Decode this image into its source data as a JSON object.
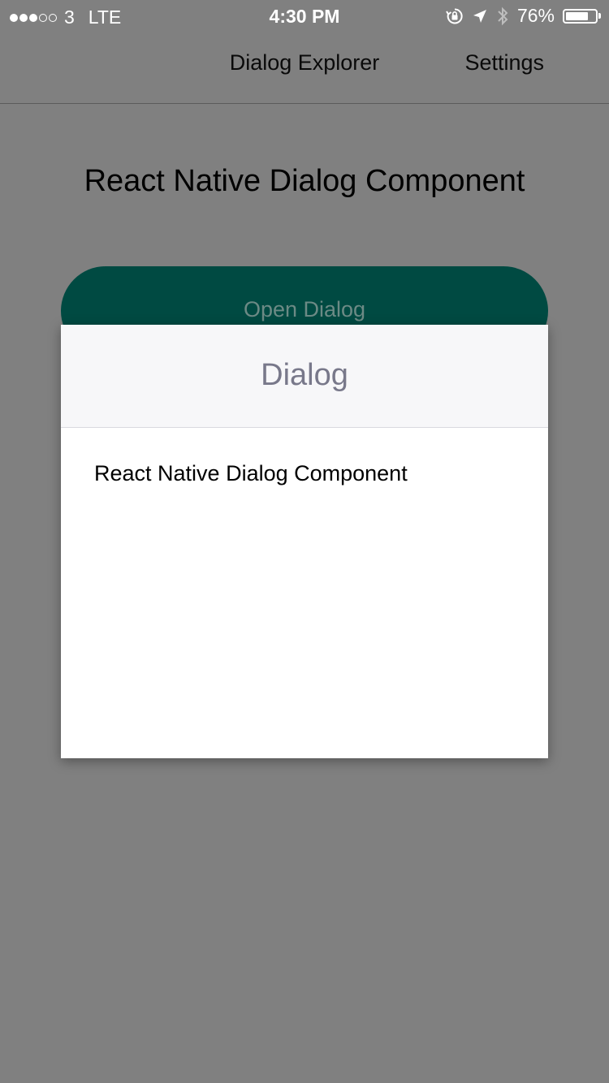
{
  "status_bar": {
    "carrier": "3",
    "network": "LTE",
    "time": "4:30 PM",
    "battery_percent": "76%",
    "battery_level": 0.76,
    "icons": [
      "orientation-lock-icon",
      "location-arrow-icon",
      "bluetooth-icon",
      "battery-icon"
    ]
  },
  "nav_bar": {
    "title": "Dialog Explorer",
    "right_action": "Settings"
  },
  "main": {
    "heading": "React Native Dialog Component",
    "open_button_label": "Open Dialog"
  },
  "dialog": {
    "title": "Dialog",
    "body": "React Native Dialog Component"
  },
  "colors": {
    "overlay_background": "#808080",
    "button_background": "#004a42",
    "dialog_header_background": "#f7f7f9",
    "dialog_title": "#78788a"
  }
}
